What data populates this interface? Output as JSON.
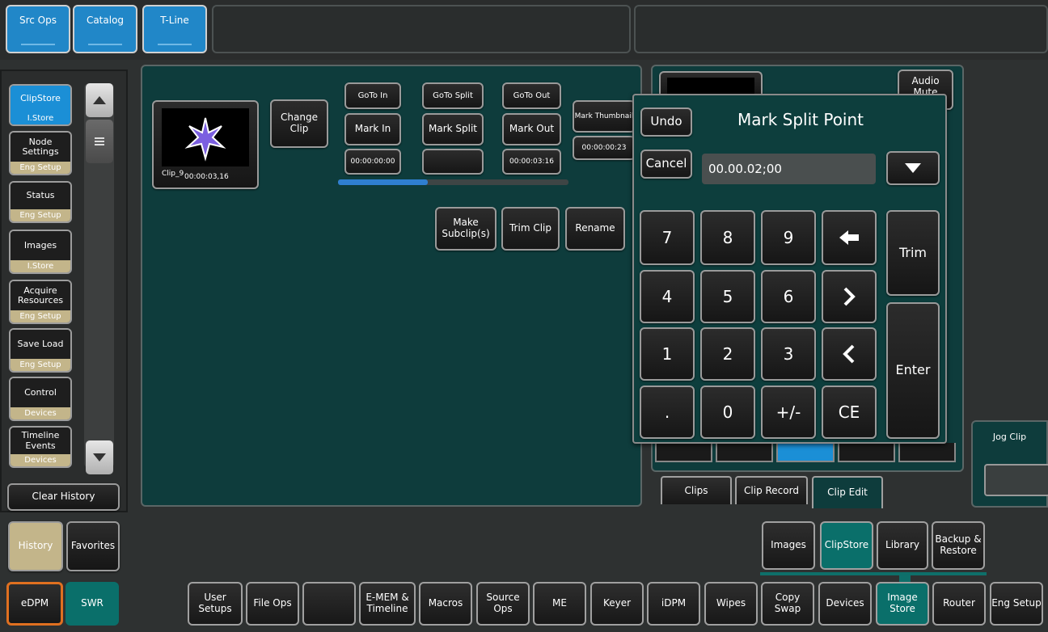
{
  "top_tabs": [
    "Src Ops",
    "Catalog",
    "T-Line"
  ],
  "sidebar": {
    "items": [
      {
        "label": "ClipStore",
        "sub": "I.Store",
        "active": true
      },
      {
        "label": "Node Settings",
        "sub": "Eng Setup"
      },
      {
        "label": "Status",
        "sub": "Eng Setup"
      },
      {
        "label": "Images",
        "sub": "I.Store"
      },
      {
        "label": "Acquire Resources",
        "sub": "Eng Setup"
      },
      {
        "label": "Save Load",
        "sub": "Eng Setup"
      },
      {
        "label": "Control",
        "sub": "Devices"
      },
      {
        "label": "Timeline Events",
        "sub": "Devices"
      }
    ],
    "clear_history": "Clear History",
    "history": "History",
    "favorites": "Favorites"
  },
  "clip": {
    "name": "Clip_9",
    "duration": "00:00:03,16",
    "change_clip": "Change Clip"
  },
  "controls": {
    "goto_in": "GoTo In",
    "goto_split": "GoTo Split",
    "goto_out": "GoTo Out",
    "mark_thumbnail": "Mark Thumbnail",
    "mark_in": "Mark In",
    "mark_split": "Mark Split",
    "mark_out": "Mark Out",
    "in_time": "00:00:00:00",
    "split_time": "",
    "out_time": "00:00:03:16",
    "thumb_time": "00:00:00:23",
    "progress": 0.39,
    "make_subclips": "Make Subclip(s)",
    "trim_clip": "Trim Clip",
    "rename": "Rename"
  },
  "right_panel": {
    "audio_mute": "Audio Mute",
    "jog_clip": "Jog Clip",
    "tabs": [
      "Clips",
      "Clip Record",
      "Clip Edit"
    ]
  },
  "dialog": {
    "title": "Mark Split Point",
    "undo": "Undo",
    "cancel": "Cancel",
    "value": "00.00.02;00",
    "keys": [
      "7",
      "8",
      "9",
      "4",
      "5",
      "6",
      "1",
      "2",
      "3",
      ".",
      "0",
      "+/-",
      "CE"
    ],
    "trim": "Trim",
    "enter": "Enter"
  },
  "sub_nav": [
    "Images",
    "ClipStore",
    "Library",
    "Backup & Restore"
  ],
  "mode": {
    "edpm": "eDPM",
    "swr": "SWR"
  },
  "bottom_nav": [
    "User Setups",
    "File Ops",
    "",
    "E-MEM & Timeline",
    "Macros",
    "Source Ops",
    "ME",
    "Keyer",
    "iDPM",
    "Wipes",
    "Copy Swap",
    "Devices",
    "Image Store",
    "Router",
    "Eng Setup"
  ],
  "colors": {
    "accent_blue": "#2187c8",
    "teal": "#0a6f6a",
    "panel": "#0e3c3c",
    "gold": "#c3b58a",
    "orange": "#e07020"
  }
}
